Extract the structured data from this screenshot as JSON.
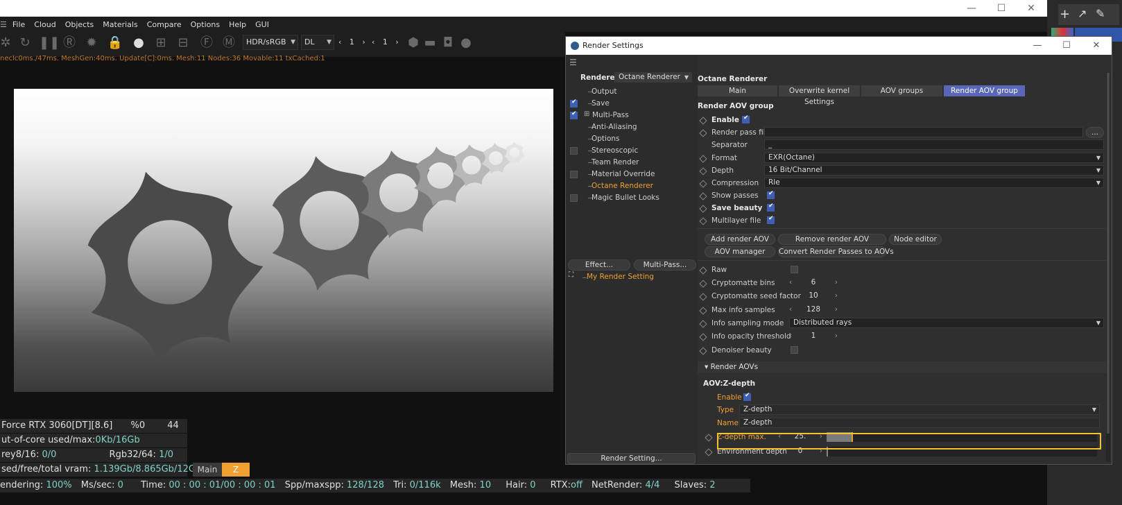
{
  "menu": [
    "File",
    "Cloud",
    "Objects",
    "Materials",
    "Compare",
    "Options",
    "Help",
    "GUI"
  ],
  "toolbar": {
    "color_space": "HDR/sRGB",
    "kernel": "DL",
    "spin1": "1",
    "spin2": "1"
  },
  "stats_line": "neclc0ms./47ms. MeshGen:40ms. Update[C]:0ms. Mesh:11 Nodes:36 Movable:11 txCached:1",
  "hud": {
    "gpu_name": "Force RTX 3060[DT][8.6]",
    "gpu_pct": "%0",
    "gpu_temp": "44",
    "ooc_label": "ut-of-core used/max:",
    "ooc_value": "0Kb/16Gb",
    "grey_label": "rey8/16:",
    "grey_value": "0/0",
    "rgb_label": "Rgb32/64:",
    "rgb_value": "1/0",
    "vram_label": "sed/free/total vram:",
    "vram_value": "1.139Gb/8.865Gb/12Gb",
    "tab_main": "Main",
    "tab_z": "Z"
  },
  "status": {
    "rendering_label": "endering:",
    "rendering_value": "100%",
    "mss_label": "Ms/sec:",
    "mss_value": "0",
    "time_label": "Time:",
    "time_value": "00 : 00 : 01/00 : 00 : 01",
    "spp_label": "Spp/maxspp:",
    "spp_value": "128/128",
    "tri_label": "Tri:",
    "tri_value": "0/116k",
    "mesh_label": "Mesh:",
    "mesh_value": "10",
    "hair_label": "Hair:",
    "hair_value": "0",
    "rtx_label": "RTX:",
    "rtx_value": "off",
    "netrender_label": "NetRender:",
    "netrender_value": "4/4",
    "slaves_label": "Slaves:",
    "slaves_value": "2"
  },
  "render_settings": {
    "title": "Render Settings",
    "renderer_label": "Renderer",
    "renderer_value": "Octane Renderer",
    "tree": [
      {
        "label": "Output",
        "check": "none"
      },
      {
        "label": "Save",
        "check": "on"
      },
      {
        "label": "Multi-Pass",
        "check": "on"
      },
      {
        "label": "Anti-Aliasing",
        "check": "none"
      },
      {
        "label": "Options",
        "check": "none"
      },
      {
        "label": "Stereoscopic",
        "check": "off"
      },
      {
        "label": "Team Render",
        "check": "none"
      },
      {
        "label": "Material Override",
        "check": "off"
      },
      {
        "label": "Octane Renderer",
        "check": "none"
      },
      {
        "label": "Magic Bullet Looks",
        "check": "off"
      }
    ],
    "effect_button": "Effect...",
    "multipass_button": "Multi-Pass...",
    "setting_item": "My Render Setting",
    "render_setting_button": "Render Setting...",
    "panel_title": "Octane Renderer",
    "tabs": [
      "Main",
      "Overwrite kernel Settings",
      "AOV groups",
      "Render AOV group"
    ],
    "group_title": "Render AOV group",
    "enable": "Enable",
    "render_pass_file": "Render pass file",
    "browse": "...",
    "separator_label": "Separator",
    "separator_value": "_",
    "format_label": "Format",
    "format_value": "EXR(Octane)",
    "depth_label": "Depth",
    "depth_value": "16 Bit/Channel",
    "compression_label": "Compression",
    "compression_value": "Rle",
    "show_passes": "Show passes",
    "save_beauty": "Save beauty",
    "multilayer_file": "Multilayer file",
    "buttons": {
      "add": "Add render AOV",
      "remove": "Remove render AOV",
      "node_editor": "Node editor",
      "aov_manager": "AOV manager",
      "convert": "Convert Render Passes to AOVs"
    },
    "raw": "Raw",
    "crypto_bins_label": "Cryptomatte bins",
    "crypto_bins_value": "6",
    "crypto_seed_label": "Cryptomatte seed factor",
    "crypto_seed_value": "10",
    "max_info_label": "Max info samples",
    "max_info_value": "128",
    "info_mode_label": "Info sampling mode",
    "info_mode_value": "Distributed rays",
    "info_opacity_label": "Info opacity threshold",
    "info_opacity_value": "1",
    "denoiser_beauty": "Denoiser beauty",
    "render_aovs_head": "Render AOVs",
    "aov_title": "AOV:Z-depth",
    "aov_enable": "Enable",
    "aov_type_label": "Type",
    "aov_type_value": "Z-depth",
    "aov_name_label": "Name",
    "aov_name_value": "Z-depth",
    "zdepth_max_label": "Z-depth max.",
    "zdepth_max_value": "25.",
    "zdepth_max_fill": 0.25,
    "env_depth_label": "Environment depth",
    "env_depth_value": "0"
  }
}
